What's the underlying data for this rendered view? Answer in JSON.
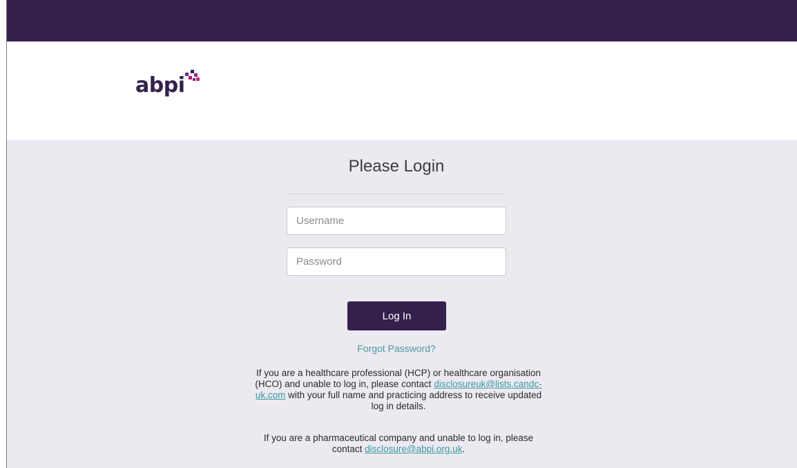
{
  "brand": {
    "logo_text": "abpi",
    "colors": {
      "primary": "#33204c",
      "accent_magenta": "#b5166b",
      "accent_purple": "#6b2a8c",
      "link": "#4a9a9c",
      "background": "#ece9f0"
    }
  },
  "login": {
    "title": "Please Login",
    "username_placeholder": "Username",
    "password_placeholder": "Password",
    "login_label": "Log In",
    "forgot_label": "Forgot Password?"
  },
  "info": {
    "hcp": {
      "line1": "If you are a healthcare professional (HCP) or healthcare organisation",
      "line2_before": "(HCO) and unable to log in, please contact ",
      "email_part1": "disclosureuk@lists.candc-",
      "email_part2": "uk.com",
      "line3_after": " with your full name and practicing address to receive updated",
      "line4": "log in details."
    },
    "company": {
      "line1": "If you are a pharmaceutical company and unable to log in, please",
      "line2_before": "contact ",
      "email": "disclosure@abpi.org.uk",
      "line2_after": "."
    }
  }
}
